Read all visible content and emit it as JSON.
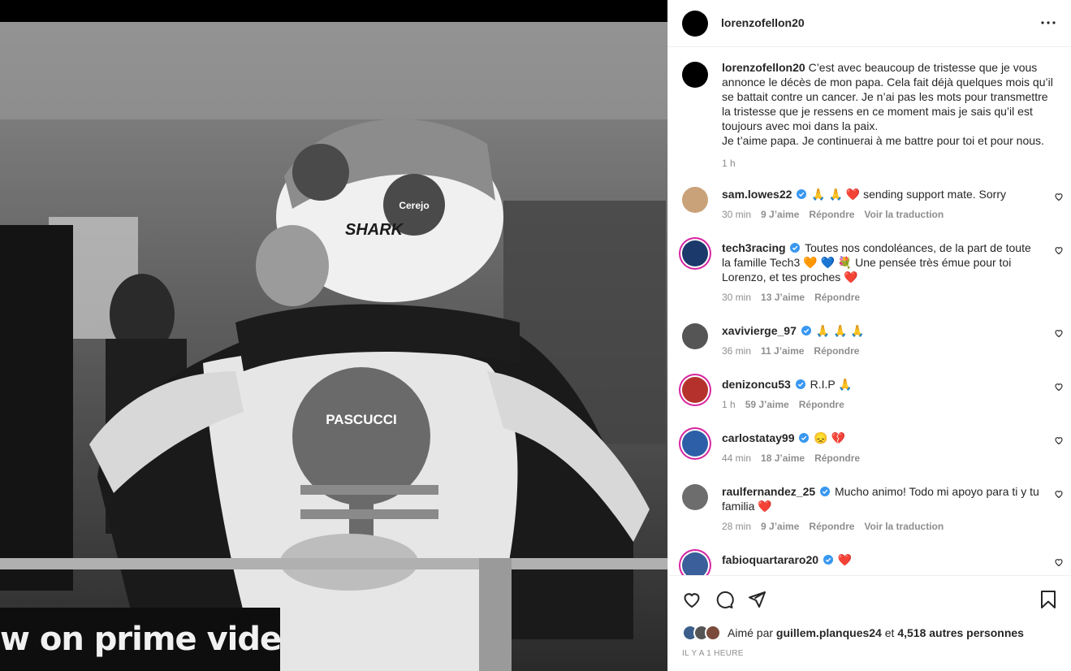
{
  "media": {
    "banner_text": "w on prime video"
  },
  "header": {
    "username": "lorenzofellon20"
  },
  "caption": {
    "username": "lorenzofellon20",
    "text": "C’est avec beaucoup de tristesse que je vous annonce le décès de mon papa. Cela fait déjà quelques mois qu’il se battait contre un cancer. Je n’ai pas les mots pour transmettre la tristesse que je ressens en ce moment mais je sais qu’il est toujours avec moi dans la paix.",
    "text2": "Je t’aime papa. Je continuerai à me battre pour toi et pour nous.",
    "time": "1 h"
  },
  "comments": [
    {
      "username": "sam.lowes22",
      "text": "🙏 🙏 ❤️ sending support mate. Sorry",
      "time": "30 min",
      "likes": "9 J’aime",
      "reply": "Répondre",
      "translate": "Voir la traduction",
      "avatar_color": "#c9a27a"
    },
    {
      "username": "tech3racing",
      "text": "Toutes nos condoléances, de la part de toute la famille Tech3 🧡 💙 💐 Une pensée très émue pour toi Lorenzo, et tes proches ❤️",
      "time": "30 min",
      "likes": "13 J’aime",
      "reply": "Répondre",
      "translate": "",
      "avatar_color": "#1b3a6b"
    },
    {
      "username": "xavivierge_97",
      "text": "🙏 🙏 🙏",
      "time": "36 min",
      "likes": "11 J’aime",
      "reply": "Répondre",
      "translate": "",
      "avatar_color": "#555555"
    },
    {
      "username": "denizoncu53",
      "text": "R.I.P 🙏",
      "time": "1 h",
      "likes": "59 J’aime",
      "reply": "Répondre",
      "translate": "",
      "avatar_color": "#b5322c"
    },
    {
      "username": "carlostatay99",
      "text": "😞 💔",
      "time": "44 min",
      "likes": "18 J’aime",
      "reply": "Répondre",
      "translate": "",
      "avatar_color": "#2d5fa8"
    },
    {
      "username": "raulfernandez_25",
      "text": "Mucho animo! Todo mi apoyo para ti y tu familia ❤️",
      "time": "28 min",
      "likes": "9 J’aime",
      "reply": "Répondre",
      "translate": "Voir la traduction",
      "avatar_color": "#6d6d6d"
    },
    {
      "username": "fabioquartararo20",
      "text": "❤️",
      "time": "",
      "likes": "",
      "reply": "",
      "translate": "",
      "avatar_color": "#3a5f9a"
    }
  ],
  "likes": {
    "prefix": "Aimé par",
    "user": "guillem.planques24",
    "and": "et",
    "others": "4,518 autres personnes"
  },
  "post_time": "IL Y A 1 HEURE",
  "colors": {
    "verified": "#3897f0",
    "heart": "#ed4956",
    "muted": "#8e8e8e"
  }
}
